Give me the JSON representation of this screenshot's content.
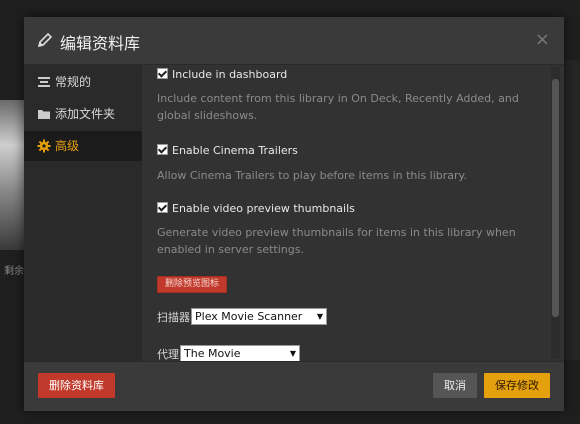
{
  "background": {
    "caption": "剩余"
  },
  "modal": {
    "title": "编辑资料库",
    "close_glyph": "×"
  },
  "sidebar": {
    "items": [
      {
        "label": "常规的",
        "icon": "list-icon"
      },
      {
        "label": "添加文件夹",
        "icon": "folder-icon"
      },
      {
        "label": "高级",
        "icon": "gear-icon",
        "active": true
      }
    ]
  },
  "options": [
    {
      "label": "Include in dashboard",
      "checked": true,
      "description": "Include content from this library in On Deck, Recently Added, and global slideshows."
    },
    {
      "label": "Enable Cinema Trailers",
      "checked": true,
      "description": "Allow Cinema Trailers to play before items in this library."
    },
    {
      "label": "Enable video preview thumbnails",
      "checked": true,
      "description": "Generate video preview thumbnails for items in this library when enabled in server settings."
    }
  ],
  "delete_previews_label": "删除预览图标",
  "scanner": {
    "label": "扫描器",
    "value": "Plex Movie Scanner"
  },
  "agent": {
    "label": "代理",
    "value": "The Movie Database"
  },
  "footer": {
    "delete_label": "删除资料库",
    "cancel_label": "取消",
    "save_label": "保存修改"
  },
  "colors": {
    "accent": "#e5a00d",
    "danger": "#c0392b",
    "modal_bg": "#323232",
    "sidebar_bg": "#2a2a2a"
  }
}
